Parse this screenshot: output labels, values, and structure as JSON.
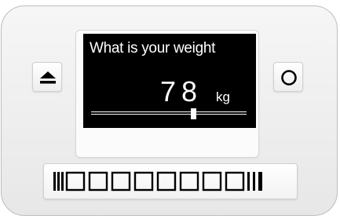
{
  "screen": {
    "question": "What is your weight",
    "value": "78",
    "unit": "kg",
    "slider_fraction": 0.66
  },
  "buttons": {
    "left_icon": "eject-icon",
    "right_icon": "circle-icon"
  },
  "colors": {
    "screen_bg": "#000000",
    "screen_text": "#ffffff",
    "device_body": "#eeeeee"
  }
}
